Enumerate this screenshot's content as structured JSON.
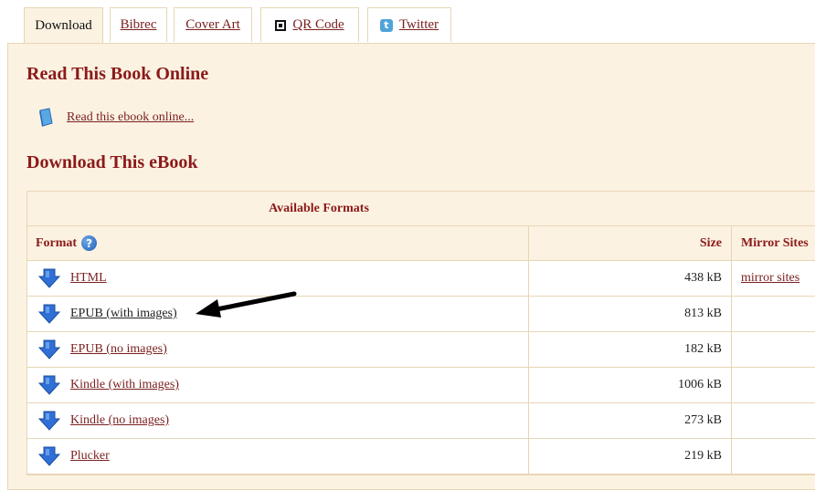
{
  "tabs": [
    {
      "label": "Download",
      "active": true
    },
    {
      "label": "Bibrec",
      "active": false
    },
    {
      "label": "Cover Art",
      "active": false
    },
    {
      "label": "QR Code",
      "icon": "qr-code-icon",
      "active": false
    },
    {
      "label": "Twitter",
      "icon": "twitter-icon",
      "active": false
    }
  ],
  "read_online": {
    "title": "Read This Book Online",
    "link_label": "Read this ebook online...",
    "icon": "book-icon"
  },
  "download": {
    "title": "Download This eBook",
    "table": {
      "caption": "Available Formats",
      "headers": {
        "format": "Format",
        "size": "Size",
        "mirror": "Mirror Sites"
      },
      "rows": [
        {
          "format": "HTML",
          "size": "438 kB",
          "mirror": "mirror sites"
        },
        {
          "format": "EPUB (with images)",
          "size": "813 kB",
          "mirror": ""
        },
        {
          "format": "EPUB (no images)",
          "size": "182 kB",
          "mirror": ""
        },
        {
          "format": "Kindle (with images)",
          "size": "1006 kB",
          "mirror": ""
        },
        {
          "format": "Kindle (no images)",
          "size": "273 kB",
          "mirror": ""
        },
        {
          "format": "Plucker",
          "size": "219 kB",
          "mirror": ""
        }
      ]
    }
  },
  "colors": {
    "panel_bg": "#fbf2e2",
    "border": "#e8d6b4",
    "heading": "#8b1a1a",
    "link": "#7a1f1f",
    "download_icon": "#2f6fd6"
  }
}
